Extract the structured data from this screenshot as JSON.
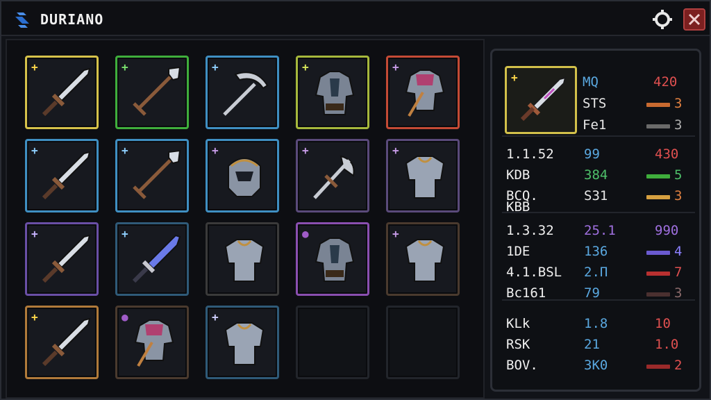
{
  "window": {
    "title": "DURIANO"
  },
  "slots": [
    {
      "kind": "sword",
      "rarity": "#d6c24a",
      "plus": "+",
      "plus_color": "#ffd84a"
    },
    {
      "kind": "spear",
      "rarity": "#3fae3c",
      "plus": "+",
      "plus_color": "#7be36e"
    },
    {
      "kind": "pickaxe",
      "rarity": "#3f8fc2",
      "plus": "+",
      "plus_color": "#8fd0ff"
    },
    {
      "kind": "armor",
      "rarity": "#a6b83c",
      "plus": "+",
      "plus_color": "#d7e65a"
    },
    {
      "kind": "armor-red",
      "rarity": "#c44a35",
      "plus": "+",
      "plus_color": "#c89ce8"
    },
    {
      "kind": "sword",
      "rarity": "#3f8fc2",
      "plus": "+",
      "plus_color": "#8fd0ff"
    },
    {
      "kind": "spear",
      "rarity": "#3f8fc2",
      "plus": "+",
      "plus_color": "#8fd0ff"
    },
    {
      "kind": "helmet",
      "rarity": "#3f8fc2",
      "plus": "+",
      "plus_color": "#c89ce8"
    },
    {
      "kind": "axe",
      "rarity": "#5a4a7a",
      "plus": "+",
      "plus_color": "#c89ce8"
    },
    {
      "kind": "chest",
      "rarity": "#5a4a7a",
      "plus": "+",
      "plus_color": "#c89ce8"
    },
    {
      "kind": "sword",
      "rarity": "#6a4fa6",
      "plus": "+",
      "plus_color": "#c8b4ff"
    },
    {
      "kind": "sword-blue",
      "rarity": "#2f5a78",
      "plus": "+",
      "plus_color": "#8fd0ff"
    },
    {
      "kind": "chest",
      "rarity": "#3a3a3a",
      "plus": "",
      "plus_color": "#c89ce8"
    },
    {
      "kind": "armor",
      "rarity": "#8a4fb0",
      "plus": "●",
      "plus_color": "#a05cc8"
    },
    {
      "kind": "chest",
      "rarity": "#4a3a2e",
      "plus": "+",
      "plus_color": "#c89ce8"
    },
    {
      "kind": "sword",
      "rarity": "#b07a3a",
      "plus": "+",
      "plus_color": "#ffd84a"
    },
    {
      "kind": "armor-red",
      "rarity": "#4a3a2e",
      "plus": "●",
      "plus_color": "#a05cc8"
    },
    {
      "kind": "chest",
      "rarity": "#2f5a78",
      "plus": "+",
      "plus_color": "#d0d0ff"
    },
    {
      "kind": "empty",
      "rarity": "#22252b",
      "plus": "",
      "plus_color": "#000"
    },
    {
      "kind": "empty",
      "rarity": "#22252b",
      "plus": "",
      "plus_color": "#000"
    }
  ],
  "selected": {
    "plus": "+",
    "rows": [
      {
        "label": "MQ",
        "value": "420",
        "value_color": "#e05050",
        "label_color": "#5aa8e0",
        "bar": null
      },
      {
        "label": "STS",
        "value": "3",
        "value_color": "#e08040",
        "label_color": "#e8e8e8",
        "bar": "#c86a30"
      },
      {
        "label": "Fe1",
        "value": "3",
        "value_color": "#b0b0b0",
        "label_color": "#e8e8e8",
        "bar": "#6a6a6a"
      }
    ]
  },
  "groups": [
    {
      "rows": [
        {
          "a": "1.1.52",
          "b": "99",
          "b_color": "#5aa8e0",
          "c": "430",
          "c_color": "#e05050",
          "bar": null
        },
        {
          "a": "KDB",
          "b": "384",
          "b_color": "#4ec06a",
          "c": "5",
          "c_color": "#4ec06a",
          "bar": "#3fae3c"
        },
        {
          "a": "BCQ.",
          "b": "S31",
          "b_color": "#e8e8e8",
          "c": "3",
          "c_color": "#e08040",
          "bar": "#d6a040"
        },
        {
          "a": "KBB",
          "b": "",
          "b_color": "#e8e8e8",
          "c": "",
          "c_color": "#e8e8e8",
          "bar": null
        }
      ]
    },
    {
      "rows": [
        {
          "a": "1.3.32",
          "b": "25.1",
          "b_color": "#a070e0",
          "c": "990",
          "c_color": "#a070e0",
          "bar": null
        },
        {
          "a": "1DE",
          "b": "136",
          "b_color": "#5aa8e0",
          "c": "4",
          "c_color": "#8c80ff",
          "bar": "#6a5ad0"
        },
        {
          "a": "4.1.BSL",
          "b": "2.Π",
          "b_color": "#5aa8e0",
          "c": "7",
          "c_color": "#e05050",
          "bar": "#b83030"
        },
        {
          "a": "Bc161",
          "b": "79",
          "b_color": "#5aa8e0",
          "c": "3",
          "c_color": "#8a6a6a",
          "bar": "#4a3030"
        }
      ]
    },
    {
      "rows": [
        {
          "a": "KLk",
          "b": "1.8",
          "b_color": "#5aa8e0",
          "c": "10",
          "c_color": "#e05050",
          "bar": null
        },
        {
          "a": "RSK",
          "b": "21",
          "b_color": "#5aa8e0",
          "c": "1.0",
          "c_color": "#e05050",
          "bar": null
        },
        {
          "a": "BOV.",
          "b": "3K0",
          "b_color": "#5aa8e0",
          "c": "2",
          "c_color": "#e05050",
          "bar": "#9a2a2a"
        }
      ]
    }
  ]
}
